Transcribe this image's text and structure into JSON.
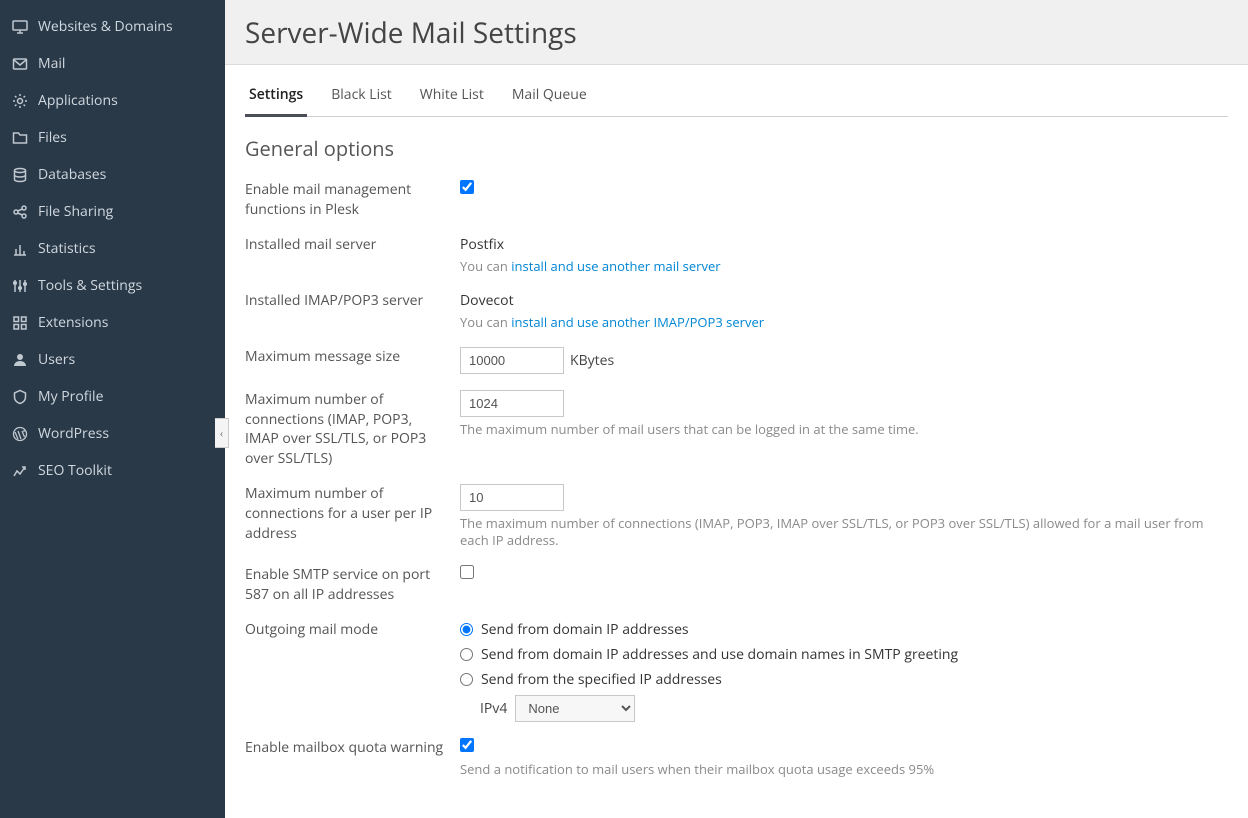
{
  "sidebar": {
    "items": [
      {
        "label": "Websites & Domains",
        "icon": "monitor"
      },
      {
        "label": "Mail",
        "icon": "envelope"
      },
      {
        "label": "Applications",
        "icon": "gear"
      },
      {
        "label": "Files",
        "icon": "folder"
      },
      {
        "label": "Databases",
        "icon": "database"
      },
      {
        "label": "File Sharing",
        "icon": "share"
      },
      {
        "label": "Statistics",
        "icon": "stats"
      },
      {
        "label": "Tools & Settings",
        "icon": "sliders"
      },
      {
        "label": "Extensions",
        "icon": "extensions"
      },
      {
        "label": "Users",
        "icon": "user"
      },
      {
        "label": "My Profile",
        "icon": "profile"
      },
      {
        "label": "WordPress",
        "icon": "wordpress"
      },
      {
        "label": "SEO Toolkit",
        "icon": "seo"
      }
    ]
  },
  "page_title": "Server-Wide Mail Settings",
  "tabs": [
    {
      "label": "Settings",
      "active": true
    },
    {
      "label": "Black List"
    },
    {
      "label": "White List"
    },
    {
      "label": "Mail Queue"
    }
  ],
  "section_title": "General options",
  "labels": {
    "enable_mail": "Enable mail management functions in Plesk",
    "installed_mail_server": "Installed mail server",
    "installed_imap_server": "Installed IMAP/POP3 server",
    "max_message_size": "Maximum message size",
    "max_connections": "Maximum number of connections (IMAP, POP3, IMAP over SSL/TLS, or POP3 over SSL/TLS)",
    "max_conn_per_ip": "Maximum number of connections for a user per IP address",
    "enable_smtp_587": "Enable SMTP service on port 587 on all IP addresses",
    "outgoing_mail_mode": "Outgoing mail mode",
    "enable_quota_warning": "Enable mailbox quota warning"
  },
  "values": {
    "mail_server": "Postfix",
    "mail_server_prefix": "You can ",
    "mail_server_link": "install and use another mail server",
    "imap_server": "Dovecot",
    "imap_server_prefix": "You can ",
    "imap_server_link": "install and use another IMAP/POP3 server",
    "max_message_size": "10000",
    "max_message_size_unit": "KBytes",
    "max_connections": "1024",
    "max_connections_hint": "The maximum number of mail users that can be logged in at the same time.",
    "max_conn_per_ip": "10",
    "max_conn_per_ip_hint": "The maximum number of connections (IMAP, POP3, IMAP over SSL/TLS, or POP3 over SSL/TLS) allowed for a mail user from each IP address.",
    "radio_opt1": "Send from domain IP addresses",
    "radio_opt2": "Send from domain IP addresses and use domain names in SMTP greeting",
    "radio_opt3": "Send from the specified IP addresses",
    "ipv4_label": "IPv4",
    "ipv4_select": "None",
    "quota_hint": "Send a notification to mail users when their mailbox quota usage exceeds 95%"
  },
  "form_state": {
    "enable_mail_checked": true,
    "enable_smtp_587_checked": false,
    "outgoing_mode_selected": 0,
    "enable_quota_checked": true
  }
}
